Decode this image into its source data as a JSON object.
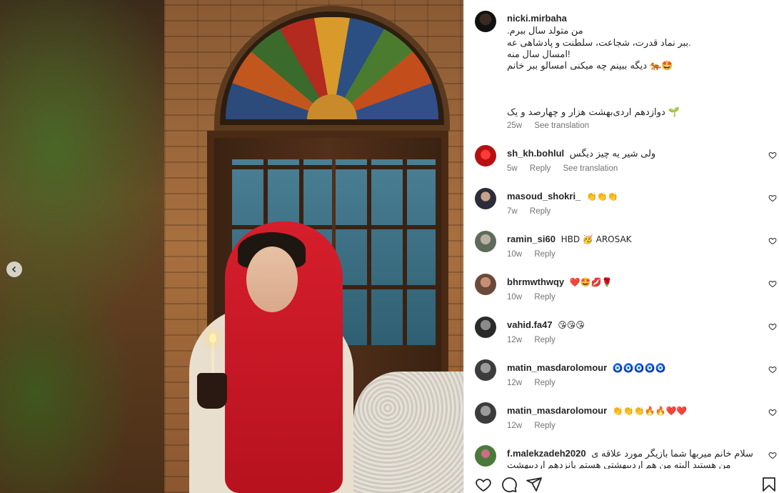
{
  "post": {
    "author": "nicki.mirbaha",
    "caption_lines": [
      "من متولد سال ببرم.",
      ".ببر نماد قدرت، شجاعت، سلطنت و پادشاهی عه",
      "!امسال سال منه",
      "🤩🐅 دیگه ببینم چه میکنی امسالو ببر خانم",
      "🌱 دوازدهم اردی‌بهشت هزار و چهارصد و یک"
    ],
    "time": "25w",
    "see_translation": "See translation"
  },
  "comments": [
    {
      "user": "sh_kh.bohlul",
      "text": "ولی شیر یه چیز دیگس",
      "time": "5w",
      "reply": "Reply",
      "translate": "See translation"
    },
    {
      "user": "masoud_shokri_",
      "text": "👏👏👏",
      "time": "7w",
      "reply": "Reply"
    },
    {
      "user": "ramin_si60",
      "text": "HBD 🥳 AROSAK",
      "time": "10w",
      "reply": "Reply"
    },
    {
      "user": "bhrmwthwqy",
      "text": "❤️🤩💋🌹",
      "time": "10w",
      "reply": "Reply"
    },
    {
      "user": "vahid.fa47",
      "text": "😘😘😘",
      "time": "12w",
      "reply": "Reply"
    },
    {
      "user": "matin_masdarolomour",
      "text": "🧿🧿🧿🧿🧿",
      "time": "12w",
      "reply": "Reply"
    },
    {
      "user": "matin_masdarolomour",
      "text": "👏👏👏🔥🔥❤️❤️",
      "time": "12w",
      "reply": "Reply"
    },
    {
      "user": "f.malekzadeh2020",
      "text": "سلام خانم میربها شما بازیگر مورد علاقه ی من هستید البته من هم اردیبهشتی هستم پانزدهم اردیبهشت",
      "time": "",
      "reply": ""
    }
  ],
  "icons": {
    "prev": "chevron-left-icon",
    "like": "heart-icon",
    "comment": "comment-icon",
    "share": "paper-plane-icon",
    "save": "bookmark-icon"
  },
  "colors": {
    "scarf": "#d61e2c",
    "meta_text": "#737373",
    "text": "#262626"
  }
}
